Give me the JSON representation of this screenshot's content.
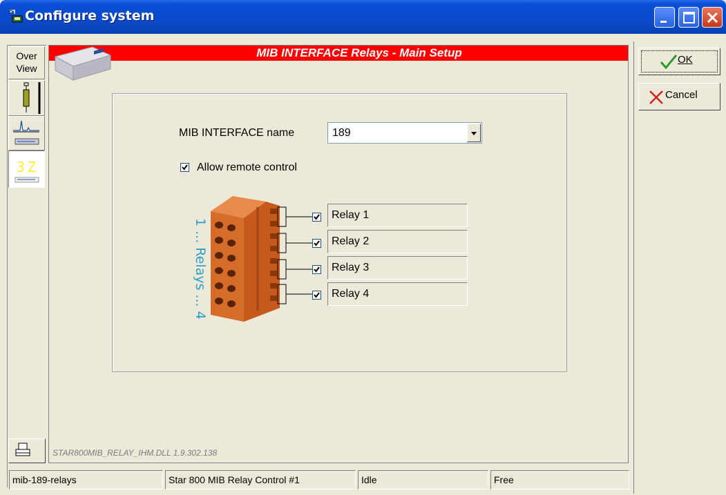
{
  "window": {
    "title": "Configure system",
    "controls": [
      "minimize-icon",
      "maximize-icon",
      "close-icon"
    ]
  },
  "left_toolbar": {
    "overview_line1": "Over",
    "overview_line2": "View",
    "items": [
      "syringe-icon",
      "chromatogram-icon",
      "relay-config-icon"
    ]
  },
  "header": {
    "title": "MIB INTERFACE  Relays - Main Setup",
    "bar_color": "#ff0000"
  },
  "form": {
    "name_label": "MIB INTERFACE name",
    "name_value": "189",
    "allow_remote_label": "Allow remote control",
    "allow_remote_checked": true,
    "relays_caption": "1 ... Relays ... 4",
    "relays": [
      {
        "label": "Relay 1",
        "checked": true
      },
      {
        "label": "Relay 2",
        "checked": true
      },
      {
        "label": "Relay 3",
        "checked": true
      },
      {
        "label": "Relay 4",
        "checked": true
      }
    ]
  },
  "dll_info": "STAR800MIB_RELAY_IHM.DLL 1.9.302.138",
  "actions": {
    "ok_label": "OK",
    "cancel_label": "Cancel"
  },
  "statusbar": {
    "cells": [
      "mib-189-relays",
      "Star 800 MIB Relay Control #1",
      "Idle",
      "Free"
    ]
  }
}
